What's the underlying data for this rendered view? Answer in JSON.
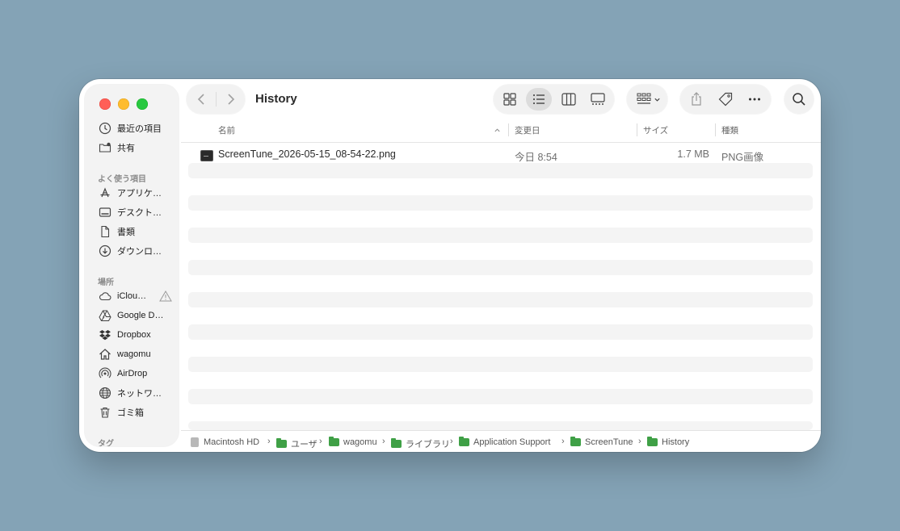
{
  "window": {
    "title": "History"
  },
  "sidebar": {
    "recents_label": "最近の項目",
    "shared_label": "共有",
    "favorites_header": "よく使う項目",
    "favorites": [
      {
        "icon": "app-icon",
        "label": "アプリケ…"
      },
      {
        "icon": "desktop-icon",
        "label": "デスクト…"
      },
      {
        "icon": "document-icon",
        "label": "書類"
      },
      {
        "icon": "download-icon",
        "label": "ダウンロ…"
      }
    ],
    "locations_header": "場所",
    "locations": [
      {
        "icon": "cloud-icon",
        "label": "iClou…"
      },
      {
        "icon": "drive-icon",
        "label": "Google D…"
      },
      {
        "icon": "dropbox-icon",
        "label": "Dropbox"
      },
      {
        "icon": "home-icon",
        "label": "wagomu"
      },
      {
        "icon": "airdrop-icon",
        "label": "AirDrop"
      },
      {
        "icon": "network-icon",
        "label": "ネットワ…"
      },
      {
        "icon": "trash-icon",
        "label": "ゴミ箱"
      }
    ],
    "tags_header": "タグ"
  },
  "columns": {
    "name": "名前",
    "date": "変更日",
    "size": "サイズ",
    "kind": "種類"
  },
  "files": [
    {
      "name": "ScreenTune_2026-05-15_08-54-22.png",
      "date": "今日 8:54",
      "size": "1.7 MB",
      "kind": "PNG画像"
    }
  ],
  "pathbar": [
    "Macintosh HD",
    "ユーザ",
    "wagomu",
    "ライブラリ",
    "Application Support",
    "ScreenTune",
    "History"
  ],
  "colors": {
    "desktop": "#84a3b6",
    "close": "#ff5f57",
    "minimize": "#febc2e",
    "maximize": "#28c840",
    "folder": "#3fa046"
  }
}
